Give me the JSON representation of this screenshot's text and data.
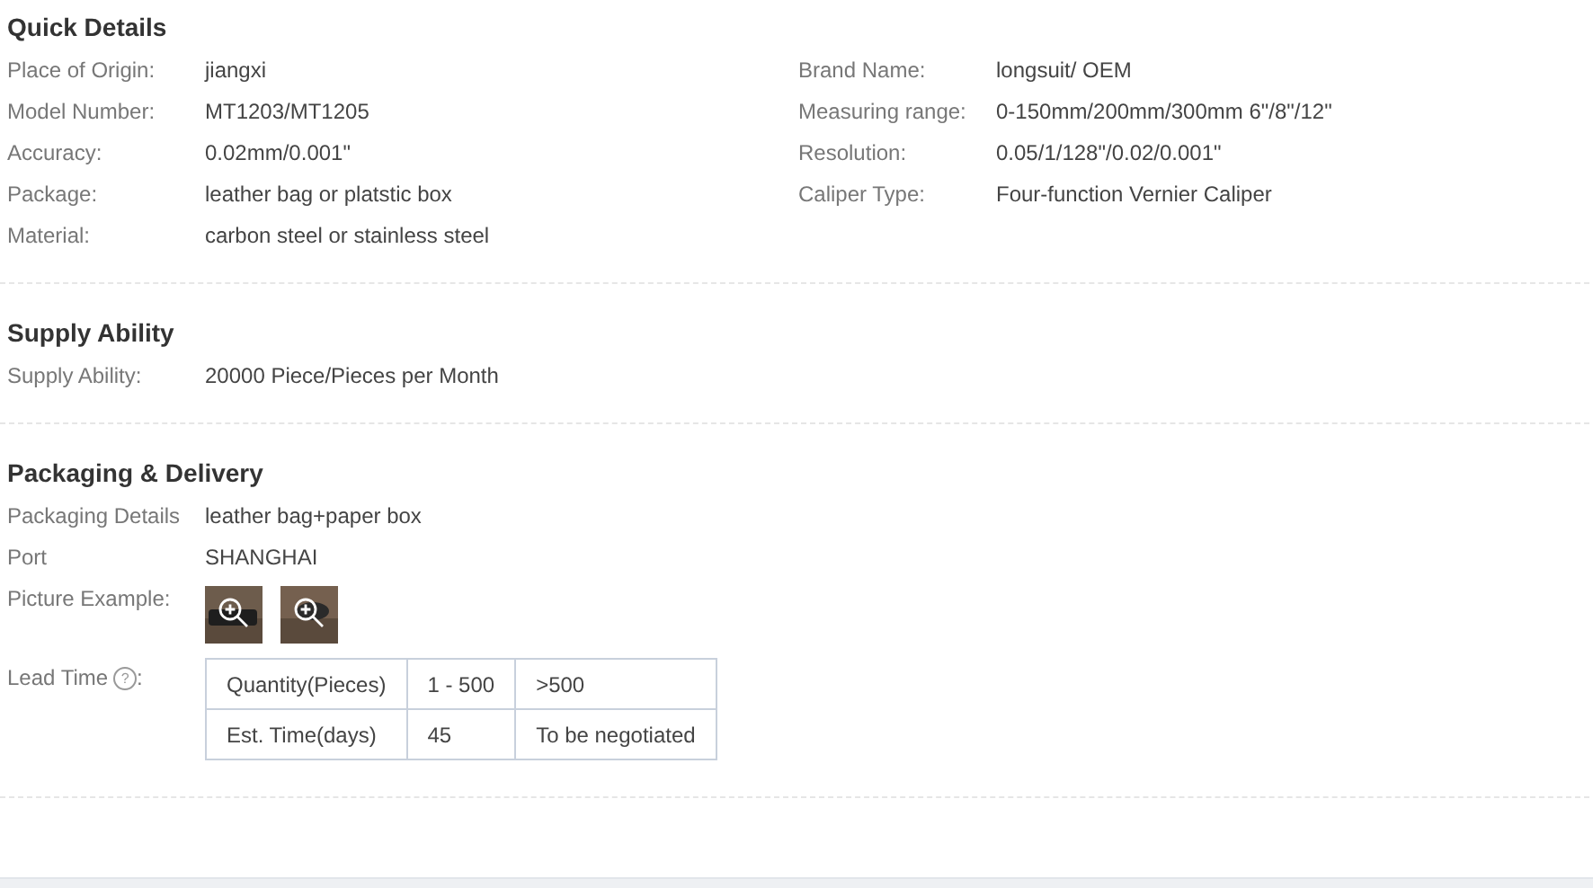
{
  "quick_details": {
    "title": "Quick Details",
    "left": [
      {
        "label": "Place of Origin:",
        "value": "jiangxi"
      },
      {
        "label": "Model Number:",
        "value": "MT1203/MT1205"
      },
      {
        "label": "Accuracy:",
        "value": "0.02mm/0.001\""
      },
      {
        "label": "Package:",
        "value": "leather bag or platstic box"
      },
      {
        "label": "Material:",
        "value": "carbon steel or stainless steel"
      }
    ],
    "right": [
      {
        "label": "Brand Name:",
        "value": "longsuit/ OEM"
      },
      {
        "label": "Measuring range:",
        "value": "0-150mm/200mm/300mm 6\"/8\"/12\""
      },
      {
        "label": "Resolution:",
        "value": "0.05/1/128\"/0.02/0.001\""
      },
      {
        "label": "Caliper Type:",
        "value": "Four-function Vernier Caliper"
      }
    ]
  },
  "supply_ability": {
    "title": "Supply Ability",
    "rows": [
      {
        "label": "Supply Ability:",
        "value": "20000 Piece/Pieces per Month"
      }
    ]
  },
  "packaging_delivery": {
    "title": "Packaging & Delivery",
    "rows": [
      {
        "label": "Packaging Details",
        "value": "leather bag+paper box"
      },
      {
        "label": "Port",
        "value": "SHANGHAI"
      }
    ],
    "pictures": {
      "label": "Picture Example:"
    },
    "lead_time": {
      "label": "Lead Time",
      "help": "?",
      "suffix": ":",
      "rows": [
        [
          "Quantity(Pieces)",
          "1 - 500",
          ">500"
        ],
        [
          "Est. Time(days)",
          "45",
          "To be negotiated"
        ]
      ]
    }
  }
}
